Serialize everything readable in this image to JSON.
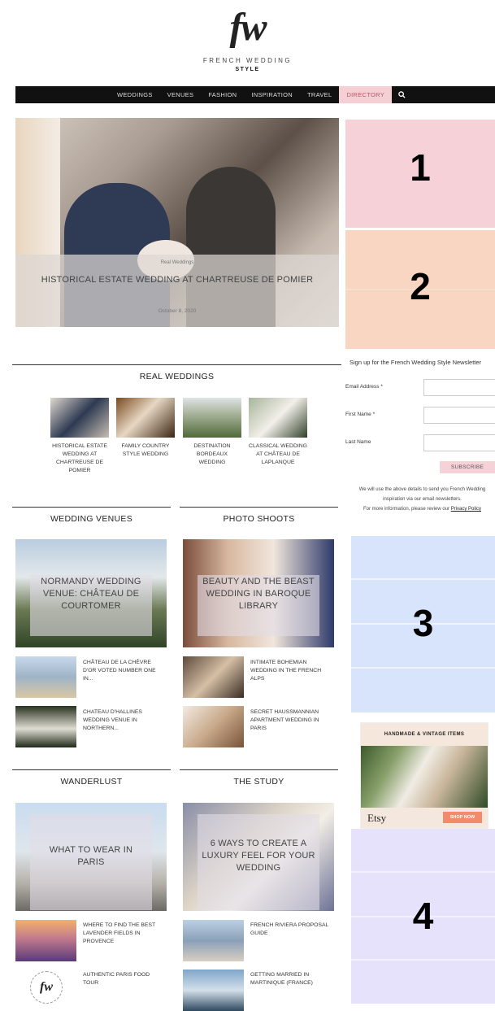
{
  "logo": {
    "mark": "fw",
    "name": "FRENCH WEDDING",
    "sub": "STYLE"
  },
  "nav": {
    "items": [
      "WEDDINGS",
      "VENUES",
      "FASHION",
      "INSPIRATION",
      "TRAVEL",
      "DIRECTORY"
    ],
    "active": "DIRECTORY",
    "search_icon": "search-icon"
  },
  "hero": {
    "category": "Real Weddings",
    "title": "HISTORICAL ESTATE WEDDING AT CHARTREUSE DE POMIER",
    "date": "October 8, 2020"
  },
  "ads": {
    "ad1": "1",
    "ad2": "2",
    "ad3": "3",
    "ad4": "4",
    "colors": [
      "#f7d1d8",
      "#f9d6c1",
      "#d7e4fb",
      "#e6e2fb"
    ]
  },
  "newsletter": {
    "title": "Sign up for the French Wedding Style Newsletter",
    "email_label": "Email Address *",
    "first_label": "First Name *",
    "last_label": "Last Name",
    "button": "SUBSCRIBE",
    "note1": "We will use the above details to send you French Wedding",
    "note2": "inspiration via our email newsletters.",
    "note3": "For more information, please review our",
    "privacy": "Privacy Policy"
  },
  "real_weddings": {
    "title": "REAL WEDDINGS",
    "items": [
      "HISTORICAL ESTATE WEDDING AT CHARTREUSE DE POMIER",
      "FAMILY COUNTRY STYLE WEDDING",
      "DESTINATION BORDEAUX WEDDING",
      "CLASSICAL WEDDING AT CHÂTEAU DE LAPLANQUE"
    ]
  },
  "venues": {
    "title": "WEDDING VENUES",
    "feature": "NORMANDY WEDDING VENUE: CHÂTEAU DE COURTOMER",
    "list": [
      "CHÂTEAU DE LA CHÈVRE D'OR VOTED NUMBER ONE IN...",
      "CHATEAU D'HALLINES WEDDING VENUE IN NORTHERN..."
    ]
  },
  "shoots": {
    "title": "PHOTO SHOOTS",
    "feature": "BEAUTY AND THE BEAST WEDDING IN BAROQUE LIBRARY",
    "list": [
      "INTIMATE BOHEMIAN WEDDING IN THE FRENCH ALPS",
      "SECRET HAUSSMANNIAN APARTMENT WEDDING IN PARIS"
    ]
  },
  "wanderlust": {
    "title": "WANDERLUST",
    "feature": "WHAT TO WEAR IN PARIS",
    "list": [
      "WHERE TO FIND THE BEST LAVENDER FIELDS IN PROVENCE",
      "AUTHENTIC PARIS FOOD TOUR"
    ]
  },
  "study": {
    "title": "THE STUDY",
    "feature": "6 WAYS TO CREATE A LUXURY FEEL FOR YOUR WEDDING",
    "list": [
      "FRENCH RIVIERA PROPOSAL GUIDE",
      "GETTING MARRIED IN MARTINIQUE (FRANCE)"
    ]
  },
  "etsy": {
    "header": "HANDMADE & VINTAGE ITEMS",
    "logo": "Etsy",
    "button": "SHOP NOW"
  }
}
